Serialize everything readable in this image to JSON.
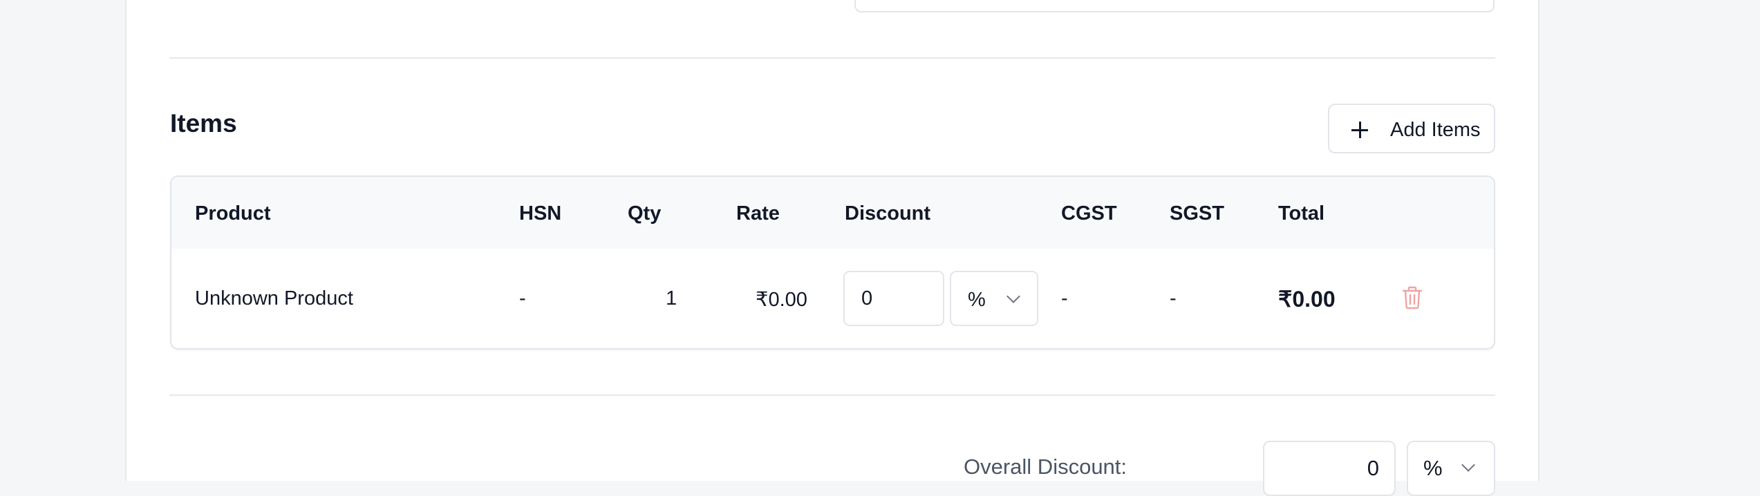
{
  "items_section": {
    "title": "Items",
    "add_button_label": "Add Items"
  },
  "table": {
    "columns": [
      "Product",
      "HSN",
      "Qty",
      "Rate",
      "Discount",
      "CGST",
      "SGST",
      "Total"
    ],
    "rows": [
      {
        "product": "Unknown Product",
        "hsn": "-",
        "qty": "1",
        "rate": "₹0.00",
        "discount_value": "0",
        "discount_type": "%",
        "cgst": "-",
        "sgst": "-",
        "total": "₹0.00"
      }
    ]
  },
  "overall_discount": {
    "label": "Overall Discount:",
    "value": "0",
    "type": "%"
  },
  "icons": {
    "add": "plus-icon",
    "delete": "trash-icon",
    "dropdown": "chevron-down-icon"
  },
  "colors": {
    "delete_icon": "#f0a3a3",
    "header_bg": "#f8f9fb",
    "border": "#e2e5ea"
  }
}
